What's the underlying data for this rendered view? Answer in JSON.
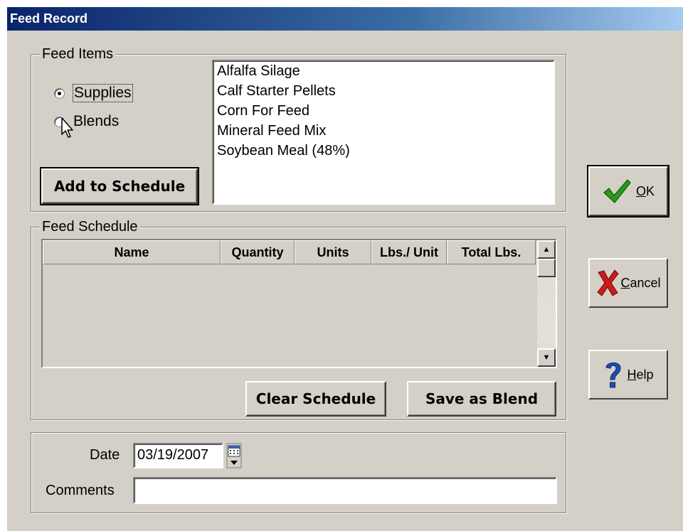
{
  "window": {
    "title": "Feed Record"
  },
  "feed_items": {
    "legend": "Feed Items",
    "radios": [
      {
        "label": "Supplies",
        "checked": true
      },
      {
        "label": "Blends",
        "checked": false
      }
    ],
    "add_button": "Add to Schedule",
    "list": [
      "Alfalfa Silage",
      "Calf Starter Pellets",
      "Corn For Feed",
      "Mineral Feed Mix",
      "Soybean Meal (48%)"
    ]
  },
  "feed_schedule": {
    "legend": "Feed Schedule",
    "columns": [
      "Name",
      "Quantity",
      "Units",
      "Lbs./ Unit",
      "Total Lbs."
    ],
    "clear_button": "Clear Schedule",
    "save_button": "Save as Blend"
  },
  "footer": {
    "date_label": "Date",
    "date_value": "03/19/2007",
    "comments_label": "Comments",
    "comments_value": ""
  },
  "side_buttons": {
    "ok_first": "O",
    "ok_rest": "K",
    "cancel_first": "C",
    "cancel_rest": "ancel",
    "help_first": "H",
    "help_rest": "elp"
  },
  "colors": {
    "title_start": "#0a246a",
    "title_end": "#a6caf0",
    "face": "#d4d0c8",
    "ok_check": "#2a9a1a",
    "cancel_x": "#cc1a1a",
    "help_q": "#1a4fb0"
  },
  "icons": [
    "checkmark-icon",
    "red-x-icon",
    "question-mark-icon",
    "calendar-icon",
    "mouse-cursor-icon",
    "scroll-up-arrow-icon",
    "scroll-down-arrow-icon"
  ]
}
